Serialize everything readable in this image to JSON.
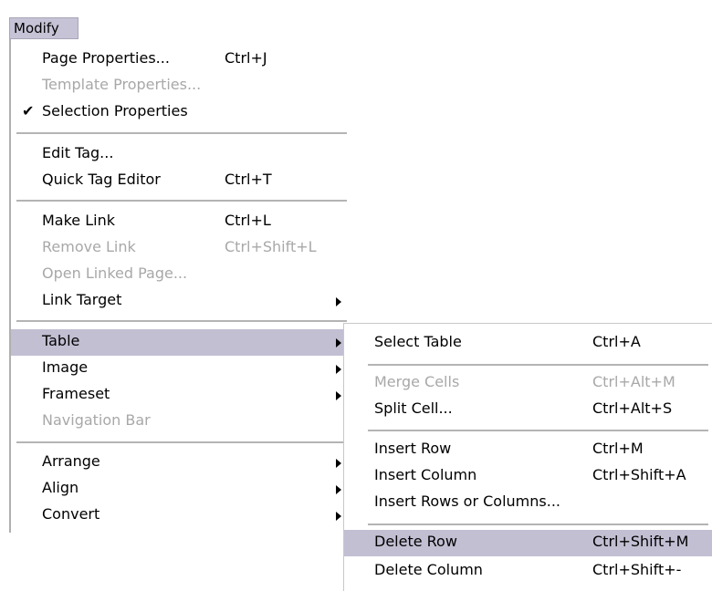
{
  "menubar": {
    "modify": "Modify"
  },
  "main_menu": {
    "page_properties": {
      "label": "Page Properties...",
      "shortcut": "Ctrl+J"
    },
    "template_properties": {
      "label": "Template Properties..."
    },
    "selection_properties": {
      "label": "Selection Properties",
      "checked": true
    },
    "edit_tag": {
      "label": "Edit Tag..."
    },
    "quick_tag_editor": {
      "label": "Quick Tag Editor",
      "shortcut": "Ctrl+T"
    },
    "make_link": {
      "label": "Make Link",
      "shortcut": "Ctrl+L"
    },
    "remove_link": {
      "label": "Remove Link",
      "shortcut": "Ctrl+Shift+L"
    },
    "open_linked_page": {
      "label": "Open Linked Page..."
    },
    "link_target": {
      "label": "Link Target"
    },
    "table": {
      "label": "Table"
    },
    "image": {
      "label": "Image"
    },
    "frameset": {
      "label": "Frameset"
    },
    "navigation_bar": {
      "label": "Navigation Bar"
    },
    "arrange": {
      "label": "Arrange"
    },
    "align": {
      "label": "Align"
    },
    "convert": {
      "label": "Convert"
    }
  },
  "table_submenu": {
    "select_table": {
      "label": "Select Table",
      "shortcut": "Ctrl+A"
    },
    "merge_cells": {
      "label": "Merge Cells",
      "shortcut": "Ctrl+Alt+M"
    },
    "split_cell": {
      "label": "Split Cell...",
      "shortcut": "Ctrl+Alt+S"
    },
    "insert_row": {
      "label": "Insert Row",
      "shortcut": "Ctrl+M"
    },
    "insert_column": {
      "label": "Insert Column",
      "shortcut": "Ctrl+Shift+A"
    },
    "insert_rows_or_columns": {
      "label": "Insert Rows or Columns..."
    },
    "delete_row": {
      "label": "Delete Row",
      "shortcut": "Ctrl+Shift+M"
    },
    "delete_column": {
      "label": "Delete Column",
      "shortcut": "Ctrl+Shift+-"
    }
  },
  "icons": {
    "check": "checkmark-icon",
    "submenu": "submenu-arrow-icon"
  }
}
